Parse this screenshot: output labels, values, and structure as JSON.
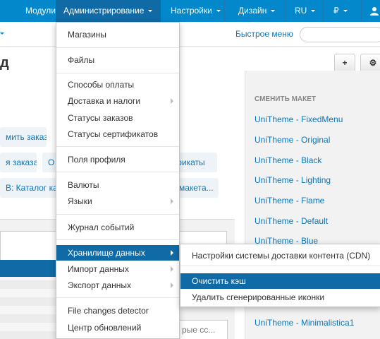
{
  "topnav": {
    "items": [
      {
        "label": "Модули"
      },
      {
        "label": "Администрирование"
      },
      {
        "label": "Настройки"
      },
      {
        "label": "Дизайн"
      },
      {
        "label": "RU"
      },
      {
        "label": "₽"
      }
    ]
  },
  "subbar": {
    "quick_menu": "Быстрое меню",
    "search_placeholder": ""
  },
  "title": {
    "fragment": "д",
    "add_button": "+",
    "settings_button": "⚙"
  },
  "content": {
    "chips": [
      "мить заказ",
      "я заказа",
      "О",
      "фикаты",
      "В: Каталог кат",
      "макета..."
    ],
    "input_fragment": "рые сс..."
  },
  "sidebar": {
    "heading": "СМЕНИТЬ МАКЕТ",
    "themes": [
      "UniTheme - FixedMenu",
      "UniTheme - Original",
      "UniTheme - Black",
      "UniTheme - Lighting",
      "UniTheme - Flame",
      "UniTheme - Default",
      "UniTheme - Blue",
      "UniTheme - Minimalistica1"
    ]
  },
  "dropdown": {
    "items": [
      {
        "label": "Магазины"
      },
      {
        "label": "Файлы"
      },
      {
        "label": "Способы оплаты"
      },
      {
        "label": "Доставка и налоги",
        "has_submenu": true
      },
      {
        "label": "Статусы заказов"
      },
      {
        "label": "Статусы сертификатов"
      },
      {
        "label": "Поля профиля"
      },
      {
        "label": "Валюты"
      },
      {
        "label": "Языки",
        "has_submenu": true
      },
      {
        "label": "Журнал событий"
      },
      {
        "label": "Хранилище данных",
        "has_submenu": true,
        "highlighted": true
      },
      {
        "label": "Импорт данных",
        "has_submenu": true
      },
      {
        "label": "Экспорт данных",
        "has_submenu": true
      },
      {
        "label": "File changes detector"
      },
      {
        "label": "Центр обновлений"
      }
    ]
  },
  "submenu": {
    "items": [
      {
        "label": "Настройки системы доставки контента (CDN)"
      },
      {
        "label": "Очистить кэш",
        "highlighted": true
      },
      {
        "label": "Удалить сгенерированные иконки"
      }
    ]
  },
  "colors": {
    "nav_bg": "#0388cc",
    "nav_active": "#0f6aa5",
    "link": "#0c76b7",
    "highlight": "#0f6aa5"
  }
}
